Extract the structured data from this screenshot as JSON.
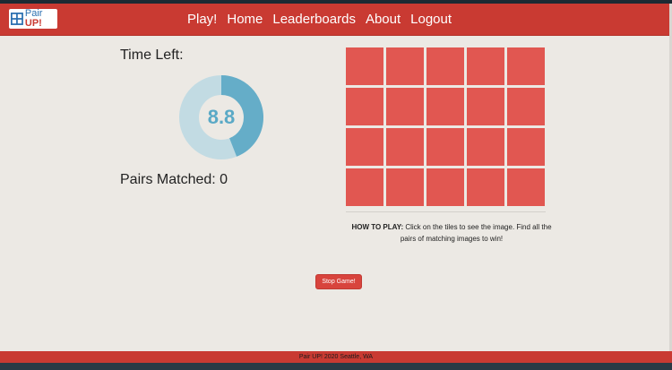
{
  "navbar": {
    "logo": {
      "text_plain": "Pair ",
      "text_bold": "UP!"
    },
    "links": [
      "Play!",
      "Home",
      "Leaderboards",
      "About",
      "Logout"
    ]
  },
  "game": {
    "time_label": "Time Left:",
    "time_value": "8.8",
    "time_remaining_fraction": 0.44,
    "pairs_label": "Pairs Matched: 0",
    "grid": {
      "rows": 4,
      "cols": 5
    },
    "howto_bold": "HOW TO PLAY:",
    "howto_text": " Click on the tiles to see the image. Find all the pairs of matching images to win!",
    "stop_label": "Stop Game!"
  },
  "footer": {
    "text": "Pair UP! 2020 Seattle, WA"
  },
  "colors": {
    "nav_bg": "#c93a32",
    "tile": "#e15751",
    "timer_fill": "#65adc8",
    "timer_track": "#c2dbe3",
    "page_bg": "#ece9e4"
  }
}
